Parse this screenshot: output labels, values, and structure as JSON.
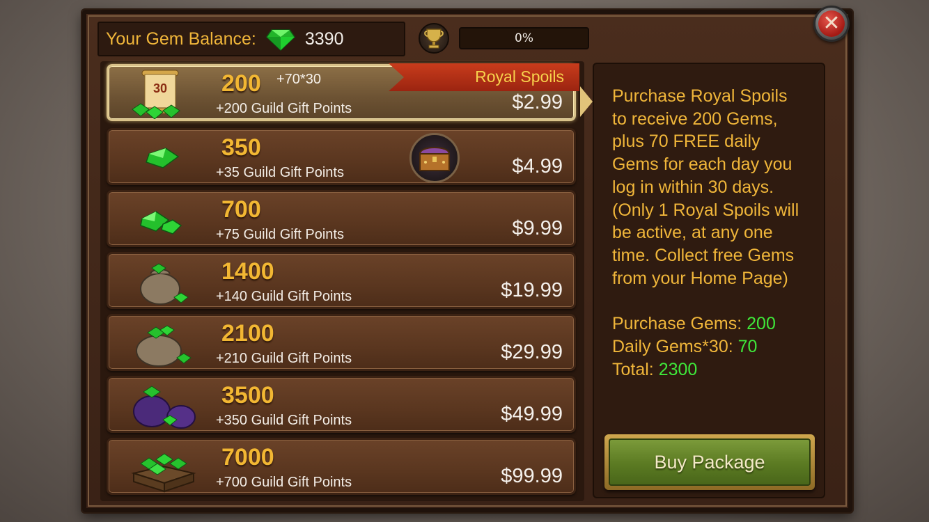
{
  "balance": {
    "label": "Your Gem Balance:",
    "value": "3390"
  },
  "progress": {
    "text": "0%",
    "percent": 0
  },
  "packages": [
    {
      "amount": "200",
      "bonus": "+70*30",
      "points": "+200 Guild Gift Points",
      "price": "$2.99",
      "ribbon": "Royal Spoils",
      "selected": true,
      "icon": "calendar-scroll-30",
      "calendar_day": "30"
    },
    {
      "amount": "350",
      "points": "+35 Guild Gift Points",
      "price": "$4.99",
      "icon": "single-gem"
    },
    {
      "amount": "700",
      "points": "+75 Guild Gift Points",
      "price": "$9.99",
      "icon": "gem-pair"
    },
    {
      "amount": "1400",
      "points": "+140 Guild Gift Points",
      "price": "$19.99",
      "icon": "gem-sack-small"
    },
    {
      "amount": "2100",
      "points": "+210 Guild Gift Points",
      "price": "$29.99",
      "icon": "gem-sack"
    },
    {
      "amount": "3500",
      "points": "+350 Guild Gift Points",
      "price": "$49.99",
      "icon": "purple-gem-sacks"
    },
    {
      "amount": "7000",
      "points": "+700 Guild Gift Points",
      "price": "$99.99",
      "icon": "gem-crate"
    }
  ],
  "description": {
    "lines": [
      "Purchase Royal Spoils",
      "to receive 200 Gems,",
      "plus 70 FREE daily",
      "Gems for each day you",
      "log in within 30 days.",
      "(Only 1 Royal Spoils will",
      "be active, at any one",
      "time. Collect free Gems",
      "from your Home Page)"
    ]
  },
  "stats": {
    "purchase_label": "Purchase Gems:",
    "purchase_value": "200",
    "daily_label": "Daily Gems*30:",
    "daily_value": "70",
    "total_label": "Total:",
    "total_value": "2300"
  },
  "buy_button": {
    "label": "Buy Package"
  },
  "colors": {
    "gold_text": "#f0b63a",
    "green_value": "#3fe83a",
    "gem_green": "#2ec32a"
  }
}
